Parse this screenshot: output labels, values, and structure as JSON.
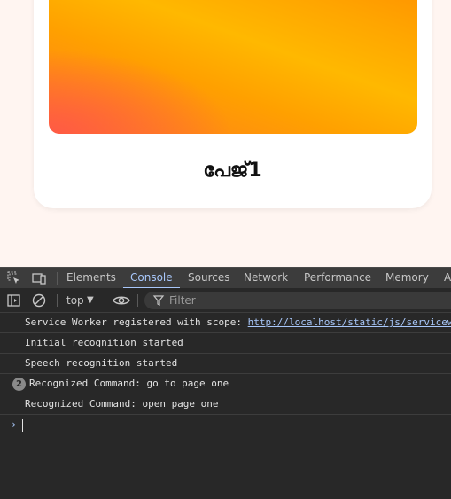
{
  "page": {
    "card_title": "പേജ്1"
  },
  "devtools": {
    "tabs": [
      {
        "label": "Elements"
      },
      {
        "label": "Console"
      },
      {
        "label": "Sources"
      },
      {
        "label": "Network"
      },
      {
        "label": "Performance"
      },
      {
        "label": "Memory"
      },
      {
        "label": "A"
      }
    ],
    "active_tab": "Console",
    "toolbar": {
      "context": "top",
      "filter_placeholder": "Filter"
    },
    "console": {
      "messages": [
        {
          "prefix": "Service Worker registered with scope: ",
          "link": "http://localhost/static/js/serviceworker"
        },
        {
          "text": "Initial recognition started"
        },
        {
          "text": "Speech recognition started"
        },
        {
          "count": "2",
          "text": "Recognized Command: go to page one"
        },
        {
          "text": "Recognized Command: open page one"
        }
      ],
      "prompt": "›"
    },
    "colors": {
      "accent": "#a8c7fa",
      "panel_bg": "#282828",
      "tabbar_bg": "#3c3c3c"
    }
  }
}
